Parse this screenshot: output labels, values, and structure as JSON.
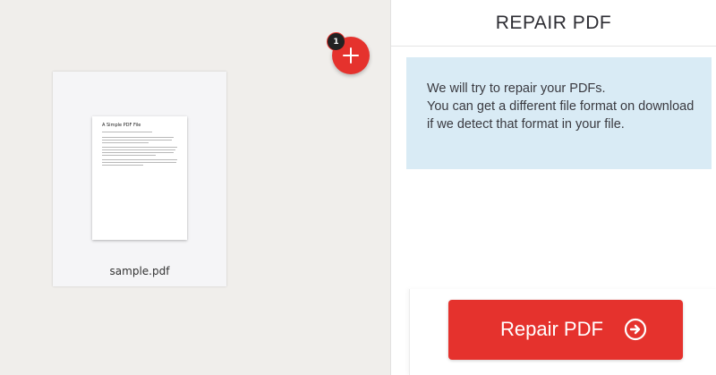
{
  "workspace": {
    "file": {
      "name": "sample.pdf",
      "preview_title": "A Simple PDF File"
    },
    "add_button": {
      "badge_count": "1",
      "icon": "plus-icon"
    }
  },
  "sidebar": {
    "title": "REPAIR PDF",
    "info": {
      "line1": "We will try to repair your PDFs.",
      "line2": "You can get a different file format on download if we detect that format in your file."
    },
    "action": {
      "label": "Repair PDF",
      "icon": "arrow-right-circle-icon"
    }
  },
  "colors": {
    "accent": "#e5322d",
    "info_bg": "#d9ebf5",
    "workspace_bg": "#f0eeeb"
  }
}
